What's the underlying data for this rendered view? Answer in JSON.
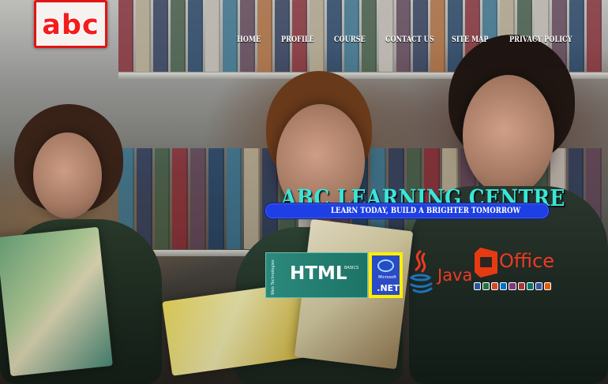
{
  "brand": {
    "logo_text": "abc"
  },
  "navigation": {
    "items": [
      {
        "label": "HOME"
      },
      {
        "label": "PROFILE"
      },
      {
        "label": "COURSE"
      },
      {
        "label": "CONTACT US"
      },
      {
        "label": "SITE MAP"
      },
      {
        "label": "PRIVACY POLICY"
      }
    ]
  },
  "hero": {
    "title": "ABC LEARNING CENTRE",
    "tagline": "LEARN TODAY, BUILD A BRIGHTER TOMORROW"
  },
  "technologies": {
    "html": {
      "label": "HTML",
      "side_text": "Web Technologies",
      "badge_text": "BASICS"
    },
    "dotnet": {
      "brand": "Microsoft",
      "label": ".NET"
    },
    "java": {
      "label": "Java"
    },
    "office": {
      "label": "Office"
    }
  },
  "colors": {
    "logo_red": "#e21414",
    "headline_cyan": "#39e6d8",
    "tagline_blue": "#1d3fe3",
    "html_green": "#2c897c",
    "dotnet_blue": "#2a4bc5",
    "dotnet_border": "#fff000",
    "java_orange": "#ef3a24",
    "office_red": "#e63b12"
  },
  "icons": {
    "java": "java-cup-icon",
    "office": "office-logo-icon",
    "dotnet": "dotnet-logo-icon"
  }
}
